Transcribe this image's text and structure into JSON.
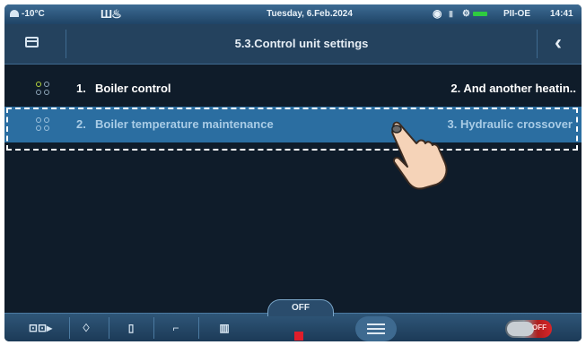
{
  "status_bar": {
    "outdoor_temp": "-10°C",
    "date": "Tuesday, 6.Feb.2024",
    "mode": "PII-OE",
    "time": "14:41"
  },
  "header": {
    "title": "5.3.Control unit settings"
  },
  "rows": [
    {
      "num": "1.",
      "label": "Boiler control",
      "right": "2. And another heatin..",
      "selected": false
    },
    {
      "num": "2.",
      "label": "Boiler temperature maintenance",
      "right": "3. Hydraulic crossover",
      "selected": true
    }
  ],
  "bottom_bar": {
    "off_label": "OFF",
    "toggle_label": "OFF"
  },
  "colors": {
    "screen_bg": "#0f1c2a",
    "selected_row": "#2b6ea1",
    "stop_red": "#e01e2b",
    "accent_green": "#2ecc40"
  },
  "icons": [
    "sun-icon",
    "radiator-icon",
    "wifi-icon",
    "pump-icon",
    "folder-icon",
    "back-chevron-icon",
    "row-dots-icon",
    "touch-hand-icon",
    "boiler-pump-icon",
    "flame-icon",
    "tank-icon",
    "tap-icon",
    "radiator-icon",
    "menu-icon"
  ]
}
